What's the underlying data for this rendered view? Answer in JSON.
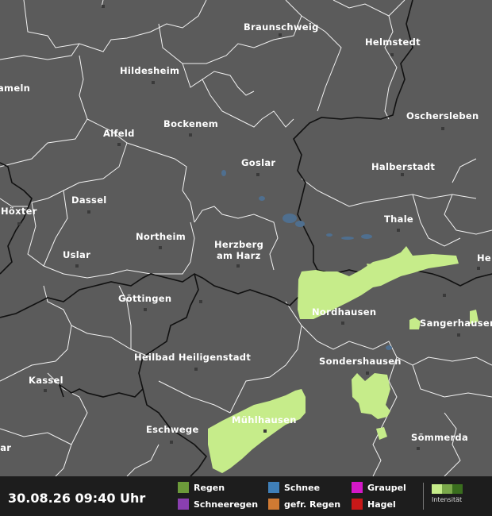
{
  "map": {
    "cities": [
      {
        "name": "Braunschweig"
      },
      {
        "name": "Helmstedt"
      },
      {
        "name": "Hildesheim"
      },
      {
        "name": "ameln"
      },
      {
        "name": "Oschersleben"
      },
      {
        "name": "Bockenem"
      },
      {
        "name": "Alfeld"
      },
      {
        "name": "Goslar"
      },
      {
        "name": "Halberstadt"
      },
      {
        "name": "Dassel"
      },
      {
        "name": "Höxter"
      },
      {
        "name": "Thale"
      },
      {
        "name": "Northeim"
      },
      {
        "name": "Herzberg"
      },
      {
        "name": "am Harz"
      },
      {
        "name": "Uslar"
      },
      {
        "name": "He"
      },
      {
        "name": "Göttingen"
      },
      {
        "name": "Nordhausen"
      },
      {
        "name": "Sangerhausen"
      },
      {
        "name": "Heilbad Heiligenstadt"
      },
      {
        "name": "Sondershausen"
      },
      {
        "name": "Kassel"
      },
      {
        "name": "Mühlhausen"
      },
      {
        "name": "Eschwege"
      },
      {
        "name": "Sömmerda"
      },
      {
        "name": "lar"
      }
    ],
    "colors": {
      "background": "#5b5b5b",
      "district_border": "#f2f2f2",
      "state_border": "#111111",
      "water": "#4f6f8f",
      "precip_light": "#c6ec8a"
    }
  },
  "legend": {
    "timestamp": "30.08.26 09:40 Uhr",
    "items": [
      {
        "label": "Regen",
        "color": "#6c9a3a"
      },
      {
        "label": "Schneeregen",
        "color": "#8a3fb0"
      },
      {
        "label": "Schnee",
        "color": "#3f7fb8"
      },
      {
        "label": "gefr. Regen",
        "color": "#d07a33"
      },
      {
        "label": "Graupel",
        "color": "#d418c8"
      },
      {
        "label": "Hagel",
        "color": "#c81818"
      }
    ],
    "intensity_label": "Intensität",
    "intensity_colors": [
      "#c6ec8a",
      "#7aa84a",
      "#3a6e1e"
    ]
  }
}
